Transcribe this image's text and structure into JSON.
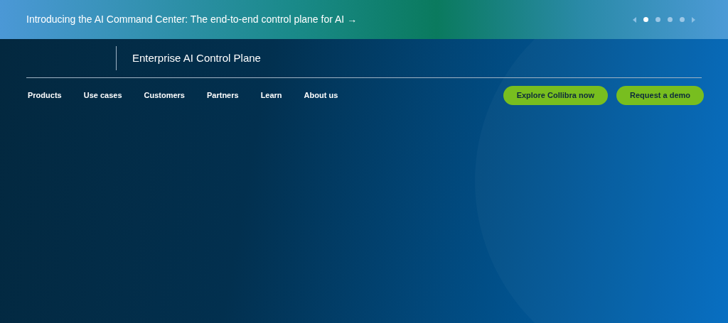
{
  "announcement": {
    "text": "Introducing the AI Command Center: The end-to-end control plane for AI",
    "arrow": "→"
  },
  "carousel": {
    "dots": [
      {
        "selected": true
      },
      {
        "selected": false
      },
      {
        "selected": false
      },
      {
        "selected": false
      }
    ]
  },
  "header": {
    "tagline": "Enterprise AI Control Plane"
  },
  "nav": {
    "items": [
      "Products",
      "Use cases",
      "Customers",
      "Partners",
      "Learn",
      "About us"
    ],
    "buttons": [
      "Explore Collibra now",
      "Request a demo"
    ]
  }
}
